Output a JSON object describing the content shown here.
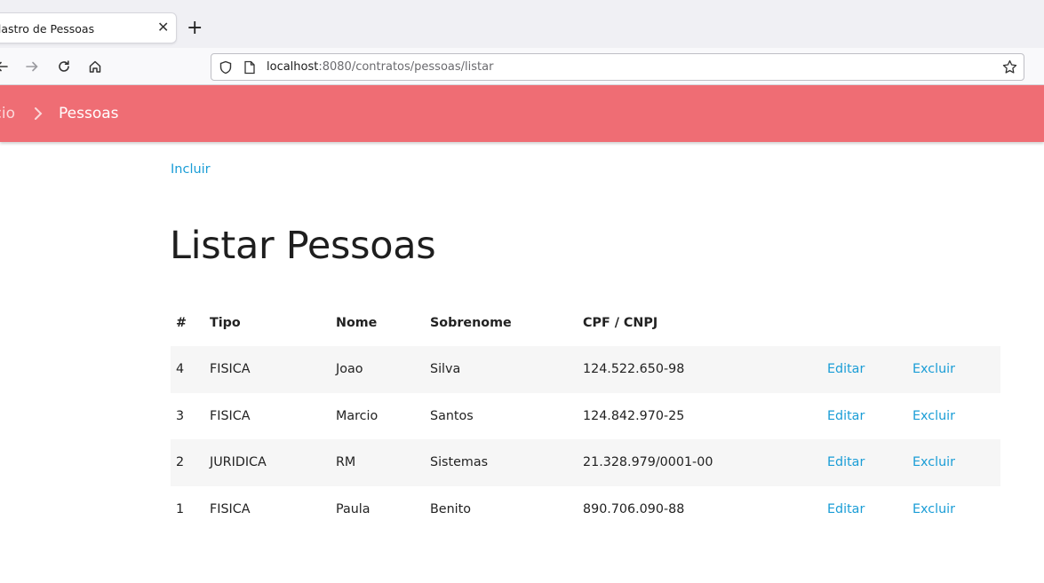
{
  "browser": {
    "tab_title": "Cadastro de Pessoas",
    "url_host": "localhost",
    "url_rest": ":8080/contratos/pessoas/listar"
  },
  "header": {
    "breadcrumb_prev": "Início",
    "breadcrumb_current": "Pessoas",
    "color": "#ef6d74"
  },
  "actions": {
    "incluir": "Incluir"
  },
  "page": {
    "title": "Listar Pessoas"
  },
  "table": {
    "columns": [
      "#",
      "Tipo",
      "Nome",
      "Sobrenome",
      "CPF / CNPJ"
    ],
    "rows": [
      {
        "id": "4",
        "tipo": "FISICA",
        "nome": "Joao",
        "sobrenome": "Silva",
        "doc": "124.522.650-98",
        "edit": "Editar",
        "delete": "Excluir"
      },
      {
        "id": "3",
        "tipo": "FISICA",
        "nome": "Marcio",
        "sobrenome": "Santos",
        "doc": "124.842.970-25",
        "edit": "Editar",
        "delete": "Excluir"
      },
      {
        "id": "2",
        "tipo": "JURIDICA",
        "nome": "RM",
        "sobrenome": "Sistemas",
        "doc": "21.328.979/0001-00",
        "edit": "Editar",
        "delete": "Excluir"
      },
      {
        "id": "1",
        "tipo": "FISICA",
        "nome": "Paula",
        "sobrenome": "Benito",
        "doc": "890.706.090-88",
        "edit": "Editar",
        "delete": "Excluir"
      }
    ]
  },
  "icons": [
    "close-icon",
    "plus-icon",
    "back-arrow-icon",
    "forward-arrow-icon",
    "reload-icon",
    "home-icon",
    "shield-icon",
    "page-icon",
    "star-icon",
    "chevron-right-icon"
  ],
  "colors": {
    "link": "#1a9dd6",
    "stripe": "#f6f6f6"
  }
}
